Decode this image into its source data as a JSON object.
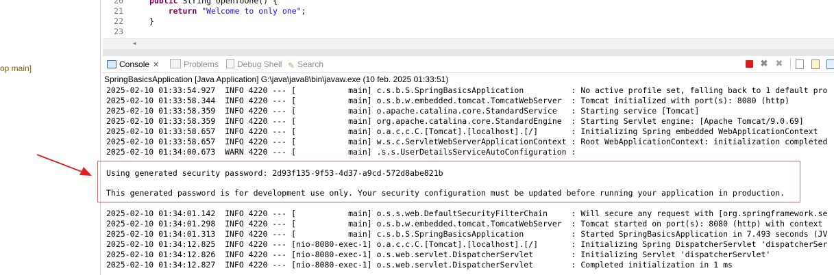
{
  "left_panel": {
    "snippet": "op main]"
  },
  "editor": {
    "lines": [
      {
        "number": "20",
        "indent": "",
        "parts": [
          {
            "t": "kw",
            "v": "public"
          },
          {
            "t": "plain",
            "v": " String openToOne() {"
          }
        ]
      },
      {
        "number": "21",
        "indent": "    ",
        "parts": [
          {
            "t": "kw",
            "v": "return"
          },
          {
            "t": "plain",
            "v": " "
          },
          {
            "t": "str",
            "v": "\"Welcome to only one\""
          },
          {
            "t": "plain",
            "v": ";"
          }
        ]
      },
      {
        "number": "22",
        "indent": "",
        "parts": [
          {
            "t": "plain",
            "v": "}"
          }
        ]
      },
      {
        "number": "23",
        "indent": "",
        "parts": []
      }
    ]
  },
  "tabs": [
    {
      "label": "Console",
      "icon": "console-icon",
      "active": true
    },
    {
      "label": "Problems",
      "icon": "problems-icon",
      "active": false
    },
    {
      "label": "Debug Shell",
      "icon": "debug-shell-icon",
      "active": false
    },
    {
      "label": "Search",
      "icon": "search-icon",
      "active": false
    }
  ],
  "toolbar": [
    {
      "icon": "terminate-icon"
    },
    {
      "icon": "remove-launch-icon"
    },
    {
      "icon": "remove-all-terminated-icon"
    },
    {
      "icon": "clear-console-icon"
    },
    {
      "icon": "scroll-lock-icon"
    },
    {
      "icon": "pin-console-icon"
    }
  ],
  "process_line": "SpringBasicsApplication [Java Application] G:\\java\\java8\\bin\\javaw.exe  (10 feb. 2025 01:33:51)",
  "log_lines_top": [
    "2025-02-10 01:33:54.927  INFO 4220 --- [           main] c.s.b.S.SpringBasicsApplication          : No active profile set, falling back to 1 default pro",
    "2025-02-10 01:33:58.344  INFO 4220 --- [           main] o.s.b.w.embedded.tomcat.TomcatWebServer  : Tomcat initialized with port(s): 8080 (http)",
    "2025-02-10 01:33:58.359  INFO 4220 --- [           main] o.apache.catalina.core.StandardService   : Starting service [Tomcat]",
    "2025-02-10 01:33:58.359  INFO 4220 --- [           main] org.apache.catalina.core.StandardEngine  : Starting Servlet engine: [Apache Tomcat/9.0.69]",
    "2025-02-10 01:33:58.657  INFO 4220 --- [           main] o.a.c.c.C.[Tomcat].[localhost].[/]       : Initializing Spring embedded WebApplicationContext",
    "2025-02-10 01:33:58.657  INFO 4220 --- [           main] w.s.c.ServletWebServerApplicationContext : Root WebApplicationContext: initialization completed",
    "2025-02-10 01:34:00.673  WARN 4220 --- [           main] .s.s.UserDetailsServiceAutoConfiguration :"
  ],
  "highlighted_lines": [
    "Using generated security password: 2d93f135-9f53-4d37-a9cd-572d8abe821b",
    "This generated password is for development use only. Your security configuration must be updated before running your application in production."
  ],
  "log_lines_bottom": [
    "2025-02-10 01:34:01.142  INFO 4220 --- [           main] o.s.s.web.DefaultSecurityFilterChain     : Will secure any request with [org.springframework.se",
    "2025-02-10 01:34:01.298  INFO 4220 --- [           main] o.s.b.w.embedded.tomcat.TomcatWebServer  : Tomcat started on port(s): 8080 (http) with context",
    "2025-02-10 01:34:01.313  INFO 4220 --- [           main] c.s.b.S.SpringBasicsApplication          : Started SpringBasicsApplication in 7.493 seconds (JV",
    "2025-02-10 01:34:12.825  INFO 4220 --- [nio-8080-exec-1] o.a.c.c.C.[Tomcat].[localhost].[/]       : Initializing Spring DispatcherServlet 'dispatcherSer",
    "2025-02-10 01:34:12.826  INFO 4220 --- [nio-8080-exec-1] o.s.web.servlet.DispatcherServlet        : Initializing Servlet 'dispatcherServlet'",
    "2025-02-10 01:34:12.827  INFO 4220 --- [nio-8080-exec-1] o.s.web.servlet.DispatcherServlet        : Completed initialization in 1 ms"
  ],
  "colors": {
    "highlight_border": "#e06666",
    "arrow": "#e02020",
    "keyword": "#7f0055",
    "string": "#2a00ff"
  }
}
